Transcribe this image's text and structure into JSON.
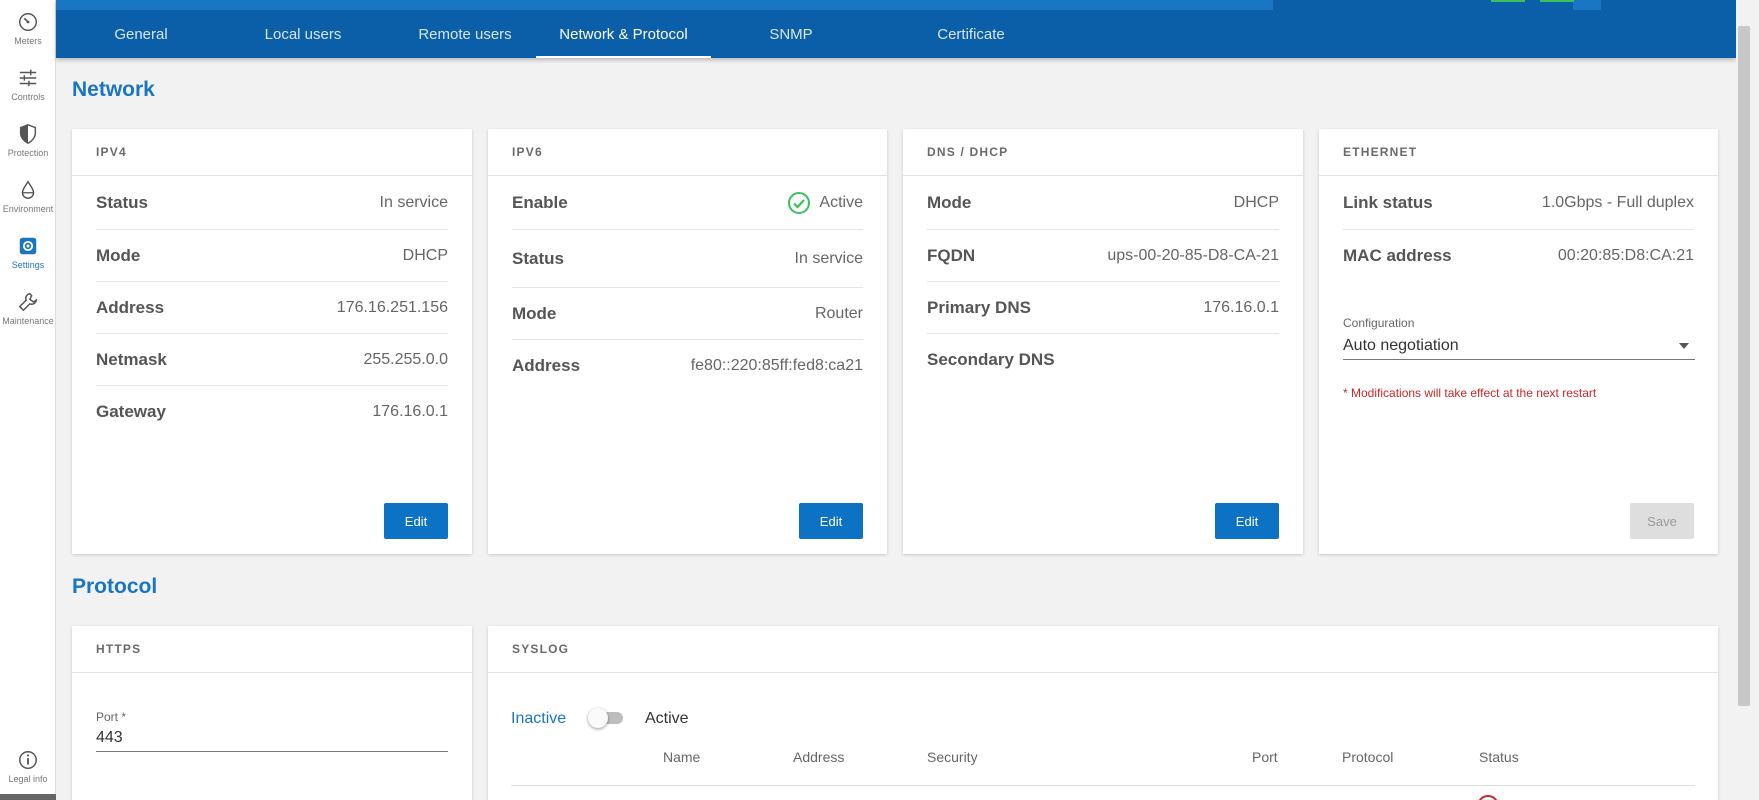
{
  "sidebar": {
    "items": [
      {
        "label": "Meters",
        "icon": "gauge-icon"
      },
      {
        "label": "Controls",
        "icon": "sliders-icon"
      },
      {
        "label": "Protection",
        "icon": "shield-icon"
      },
      {
        "label": "Environment",
        "icon": "drop-icon"
      },
      {
        "label": "Settings",
        "icon": "gear-icon"
      },
      {
        "label": "Maintenance",
        "icon": "wrench-icon"
      }
    ],
    "legal": {
      "label": "Legal info",
      "icon": "info-icon"
    }
  },
  "tabs": [
    {
      "label": "General"
    },
    {
      "label": "Local users"
    },
    {
      "label": "Remote users"
    },
    {
      "label": "Network & Protocol",
      "active": true
    },
    {
      "label": "SNMP"
    },
    {
      "label": "Certificate"
    }
  ],
  "network": {
    "title": "Network",
    "ipv4": {
      "title": "IPV4",
      "rows": [
        {
          "key": "Status",
          "value": "In service"
        },
        {
          "key": "Mode",
          "value": "DHCP"
        },
        {
          "key": "Address",
          "value": "176.16.251.156"
        },
        {
          "key": "Netmask",
          "value": "255.255.0.0"
        },
        {
          "key": "Gateway",
          "value": "176.16.0.1"
        }
      ],
      "edit_label": "Edit"
    },
    "ipv6": {
      "title": "IPV6",
      "rows": [
        {
          "key": "Enable",
          "value": "Active"
        },
        {
          "key": "Status",
          "value": "In service"
        },
        {
          "key": "Mode",
          "value": "Router"
        },
        {
          "key": "Address",
          "value": "fe80::220:85ff:fed8:ca21"
        }
      ],
      "edit_label": "Edit"
    },
    "dns": {
      "title": "DNS / DHCP",
      "rows": [
        {
          "key": "Mode",
          "value": "DHCP"
        },
        {
          "key": "FQDN",
          "value": "ups-00-20-85-D8-CA-21"
        },
        {
          "key": "Primary DNS",
          "value": "176.16.0.1"
        },
        {
          "key": "Secondary DNS",
          "value": ""
        }
      ],
      "edit_label": "Edit"
    },
    "ethernet": {
      "title": "ETHERNET",
      "rows": [
        {
          "key": "Link status",
          "value": "1.0Gbps - Full duplex"
        },
        {
          "key": "MAC address",
          "value": "00:20:85:D8:CA:21"
        }
      ],
      "config_label": "Configuration",
      "config_value": "Auto negotiation",
      "note": "* Modifications will take effect at the next restart",
      "save_label": "Save"
    }
  },
  "protocol": {
    "title": "Protocol",
    "https": {
      "title": "HTTPS",
      "port_label": "Port *",
      "port_value": "443"
    },
    "syslog": {
      "title": "SYSLOG",
      "inactive_label": "Inactive",
      "active_label": "Active",
      "columns": [
        "Name",
        "Address",
        "Security",
        "Port",
        "Protocol",
        "Status"
      ]
    }
  },
  "colors": {
    "brand": "#0b5ea8",
    "accent": "#1a76c2",
    "success": "#3cbf5c",
    "error": "#c62828"
  }
}
